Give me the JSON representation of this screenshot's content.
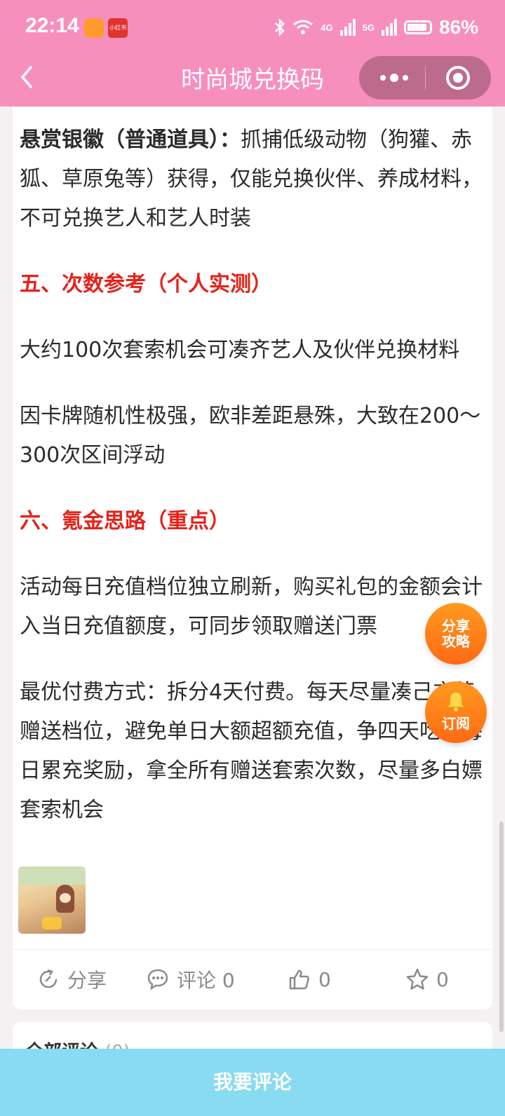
{
  "status_bar": {
    "time": "22:14",
    "app_badge_text": "小红书",
    "signal_4g": "4G",
    "signal_5g": "5G",
    "battery": "86%"
  },
  "nav": {
    "back_icon": "chevron-left-icon",
    "title": "时尚城兑换码",
    "more_icon": "more-dots-icon",
    "target_icon": "record-target-icon"
  },
  "article": {
    "p1_bold": "悬赏银徽（普通道具）：",
    "p1_text": "抓捕低级动物（狗獾、赤狐、草原兔等）获得，仅能兑换伙伴、养成材料，不可兑换艺人和艺人时装",
    "h5": "五、次数参考（个人实测）",
    "p2": "大约100次套索机会可凑齐艺人及伙伴兑换材料",
    "p3": "因卡牌随机性极强，欧非差距悬殊，大致在200～300次区间浮动",
    "h6": "六、氪金思路（重点）",
    "p4": "活动每日充值档位独立刷新，购买礼包的金额会计入当日充值额度，可同步领取赠送门票",
    "p5": "最优付费方式：拆分4天付费。每天尽量凑己充值赠送档位，避免单日大额超额充值，争四天吃满每日累充奖励，拿全所有赠送套索次数，尽量多白嫖套索机会"
  },
  "actions": {
    "share": "分享",
    "comment": "评论 0",
    "like": "0",
    "favorite": "0"
  },
  "float_buttons": {
    "guide_line1": "分享",
    "guide_line2": "攻略",
    "subscribe": "订阅"
  },
  "comments": {
    "title": "全部评论",
    "count": "(0)"
  },
  "bottom_button": "我要评论"
}
